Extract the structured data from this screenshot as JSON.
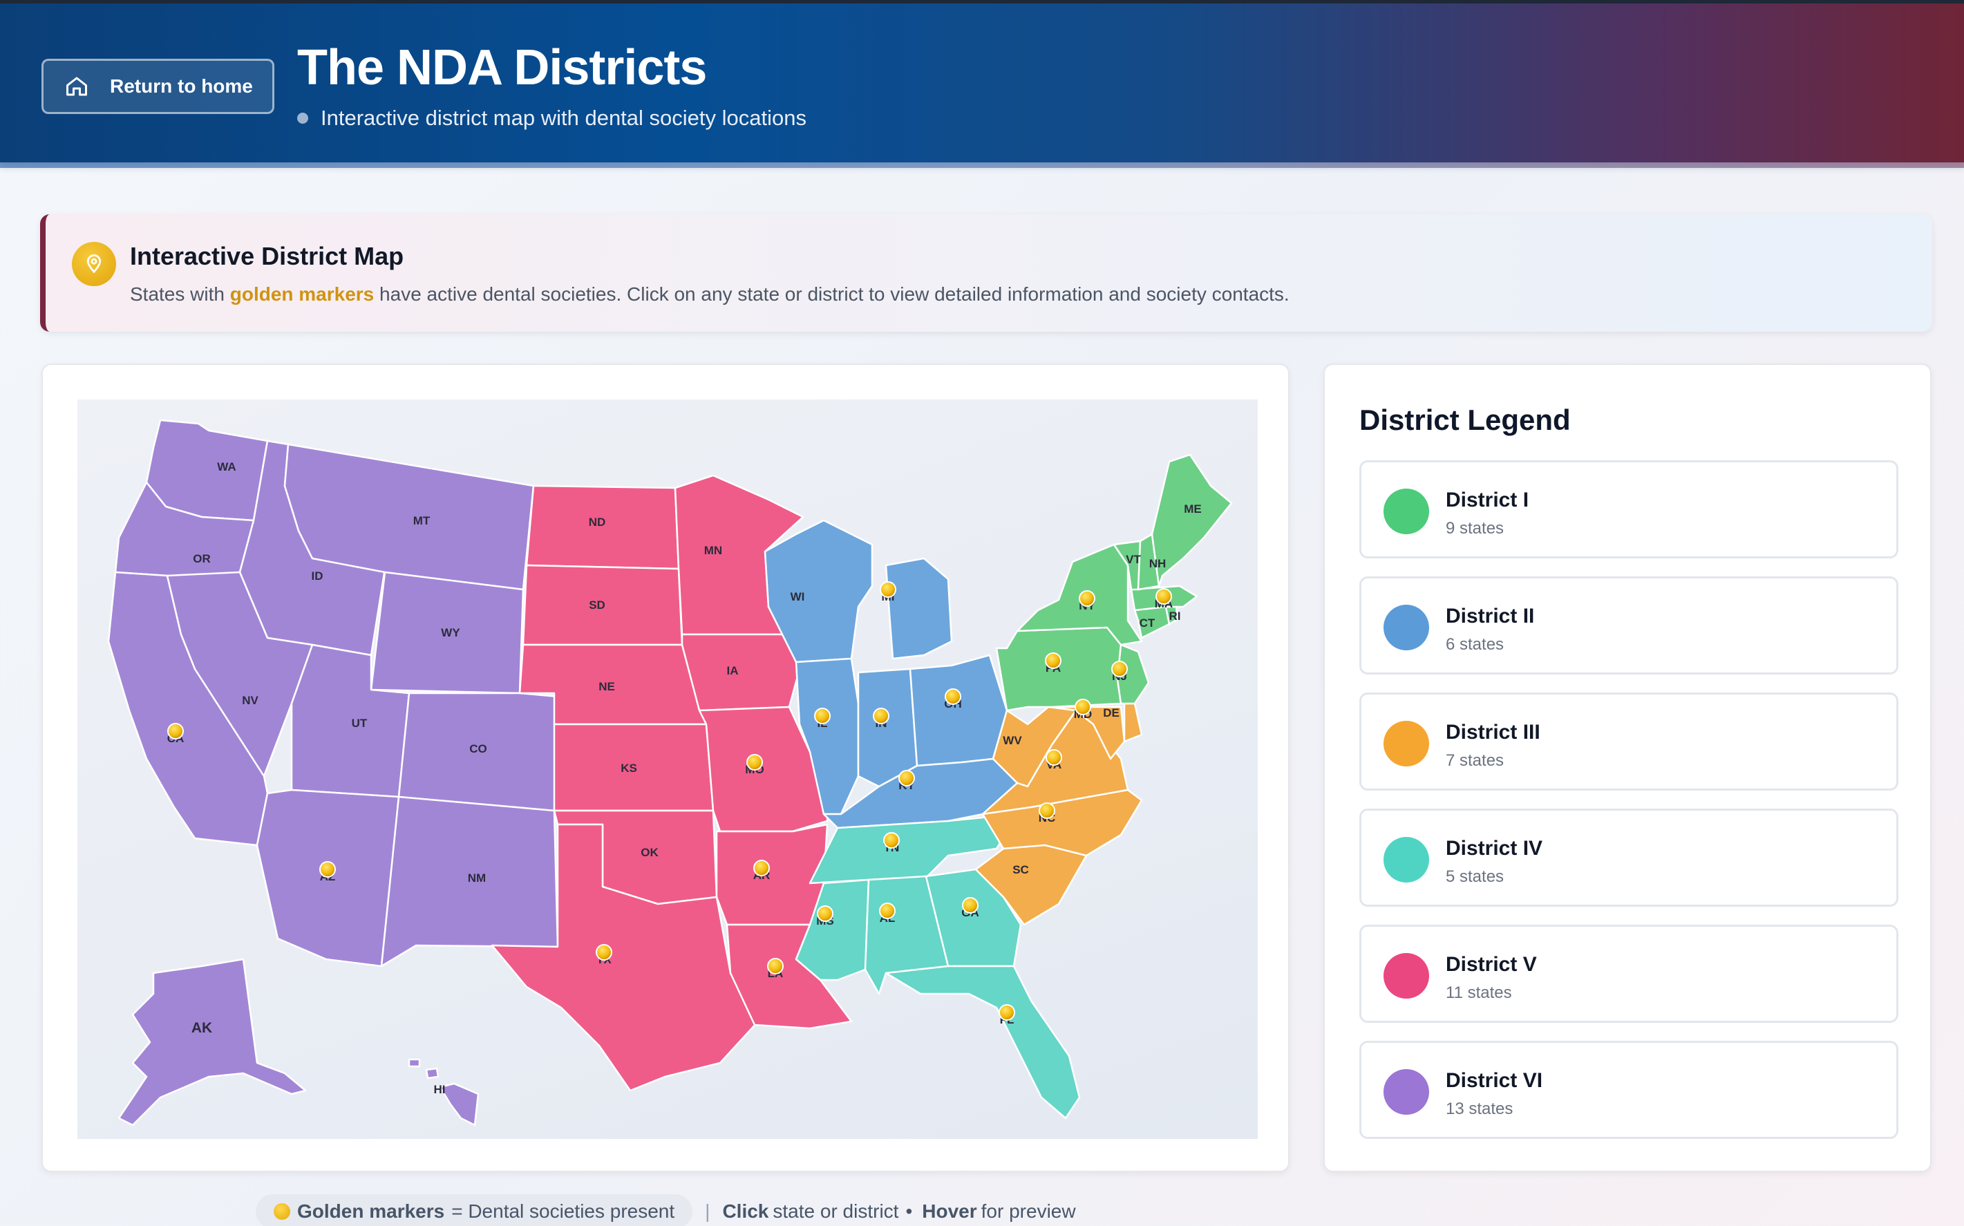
{
  "header": {
    "home_label": "Return to home",
    "title": "The NDA Districts",
    "subtitle": "Interactive district map with dental society locations"
  },
  "info": {
    "title": "Interactive District Map",
    "text_prefix": "States with ",
    "text_highlight": "golden markers",
    "text_suffix": " have active dental societies. Click on any state or district to view detailed information and society contacts."
  },
  "legend": {
    "title": "District Legend",
    "items": [
      {
        "name": "District I",
        "count": "9 states",
        "color": "#4ccb7a"
      },
      {
        "name": "District II",
        "count": "6 states",
        "color": "#5b9bd8"
      },
      {
        "name": "District III",
        "count": "7 states",
        "color": "#f5a630"
      },
      {
        "name": "District IV",
        "count": "5 states",
        "color": "#4fd4c4"
      },
      {
        "name": "District V",
        "count": "11 states",
        "color": "#ea4780"
      },
      {
        "name": "District VI",
        "count": "13 states",
        "color": "#9b76d4"
      }
    ]
  },
  "map": {
    "district_colors": {
      "I": "#6ccf86",
      "II": "#6da6dd",
      "III": "#f3ad4c",
      "IV": "#65d6c8",
      "V": "#ef5c8a",
      "VI": "#a286d6"
    },
    "states": [
      {
        "abbr": "WA",
        "district": "VI",
        "society": false
      },
      {
        "abbr": "OR",
        "district": "VI",
        "society": false
      },
      {
        "abbr": "CA",
        "district": "VI",
        "society": true
      },
      {
        "abbr": "ID",
        "district": "VI",
        "society": false
      },
      {
        "abbr": "NV",
        "district": "VI",
        "society": false
      },
      {
        "abbr": "MT",
        "district": "VI",
        "society": false
      },
      {
        "abbr": "WY",
        "district": "VI",
        "society": false
      },
      {
        "abbr": "UT",
        "district": "VI",
        "society": false
      },
      {
        "abbr": "CO",
        "district": "VI",
        "society": false
      },
      {
        "abbr": "AZ",
        "district": "VI",
        "society": true
      },
      {
        "abbr": "NM",
        "district": "VI",
        "society": false
      },
      {
        "abbr": "AK",
        "district": "VI",
        "society": false
      },
      {
        "abbr": "HI",
        "district": "VI",
        "society": false
      },
      {
        "abbr": "ND",
        "district": "V",
        "society": false
      },
      {
        "abbr": "SD",
        "district": "V",
        "society": false
      },
      {
        "abbr": "NE",
        "district": "V",
        "society": false
      },
      {
        "abbr": "KS",
        "district": "V",
        "society": false
      },
      {
        "abbr": "OK",
        "district": "V",
        "society": false
      },
      {
        "abbr": "TX",
        "district": "V",
        "society": true
      },
      {
        "abbr": "MN",
        "district": "V",
        "society": false
      },
      {
        "abbr": "IA",
        "district": "V",
        "society": false
      },
      {
        "abbr": "MO",
        "district": "V",
        "society": true
      },
      {
        "abbr": "AR",
        "district": "V",
        "society": true
      },
      {
        "abbr": "LA",
        "district": "V",
        "society": true
      },
      {
        "abbr": "WI",
        "district": "II",
        "society": false
      },
      {
        "abbr": "MI",
        "district": "II",
        "society": true
      },
      {
        "abbr": "IL",
        "district": "II",
        "society": true
      },
      {
        "abbr": "IN",
        "district": "II",
        "society": true
      },
      {
        "abbr": "OH",
        "district": "II",
        "society": true
      },
      {
        "abbr": "KY",
        "district": "II",
        "society": true
      },
      {
        "abbr": "TN",
        "district": "IV",
        "society": true
      },
      {
        "abbr": "MS",
        "district": "IV",
        "society": true
      },
      {
        "abbr": "AL",
        "district": "IV",
        "society": true
      },
      {
        "abbr": "GA",
        "district": "IV",
        "society": true
      },
      {
        "abbr": "FL",
        "district": "IV",
        "society": true
      },
      {
        "abbr": "WV",
        "district": "III",
        "society": false
      },
      {
        "abbr": "VA",
        "district": "III",
        "society": true
      },
      {
        "abbr": "NC",
        "district": "III",
        "society": true
      },
      {
        "abbr": "SC",
        "district": "III",
        "society": false
      },
      {
        "abbr": "MD",
        "district": "III",
        "society": true
      },
      {
        "abbr": "DE",
        "district": "III",
        "society": false
      },
      {
        "abbr": "PA",
        "district": "I",
        "society": true
      },
      {
        "abbr": "NJ",
        "district": "I",
        "society": true
      },
      {
        "abbr": "NY",
        "district": "I",
        "society": true
      },
      {
        "abbr": "CT",
        "district": "I",
        "society": false
      },
      {
        "abbr": "RI",
        "district": "I",
        "society": false
      },
      {
        "abbr": "MA",
        "district": "I",
        "society": true
      },
      {
        "abbr": "VT",
        "district": "I",
        "society": false
      },
      {
        "abbr": "NH",
        "district": "I",
        "society": false
      },
      {
        "abbr": "ME",
        "district": "I",
        "society": false
      }
    ]
  },
  "footer": {
    "marker_label": "Golden markers",
    "marker_text": " = Dental societies present",
    "sep": "|",
    "click_label": "Click",
    "click_text": " state or district",
    "bullet": "•",
    "hover_label": "Hover",
    "hover_text": " for preview"
  }
}
